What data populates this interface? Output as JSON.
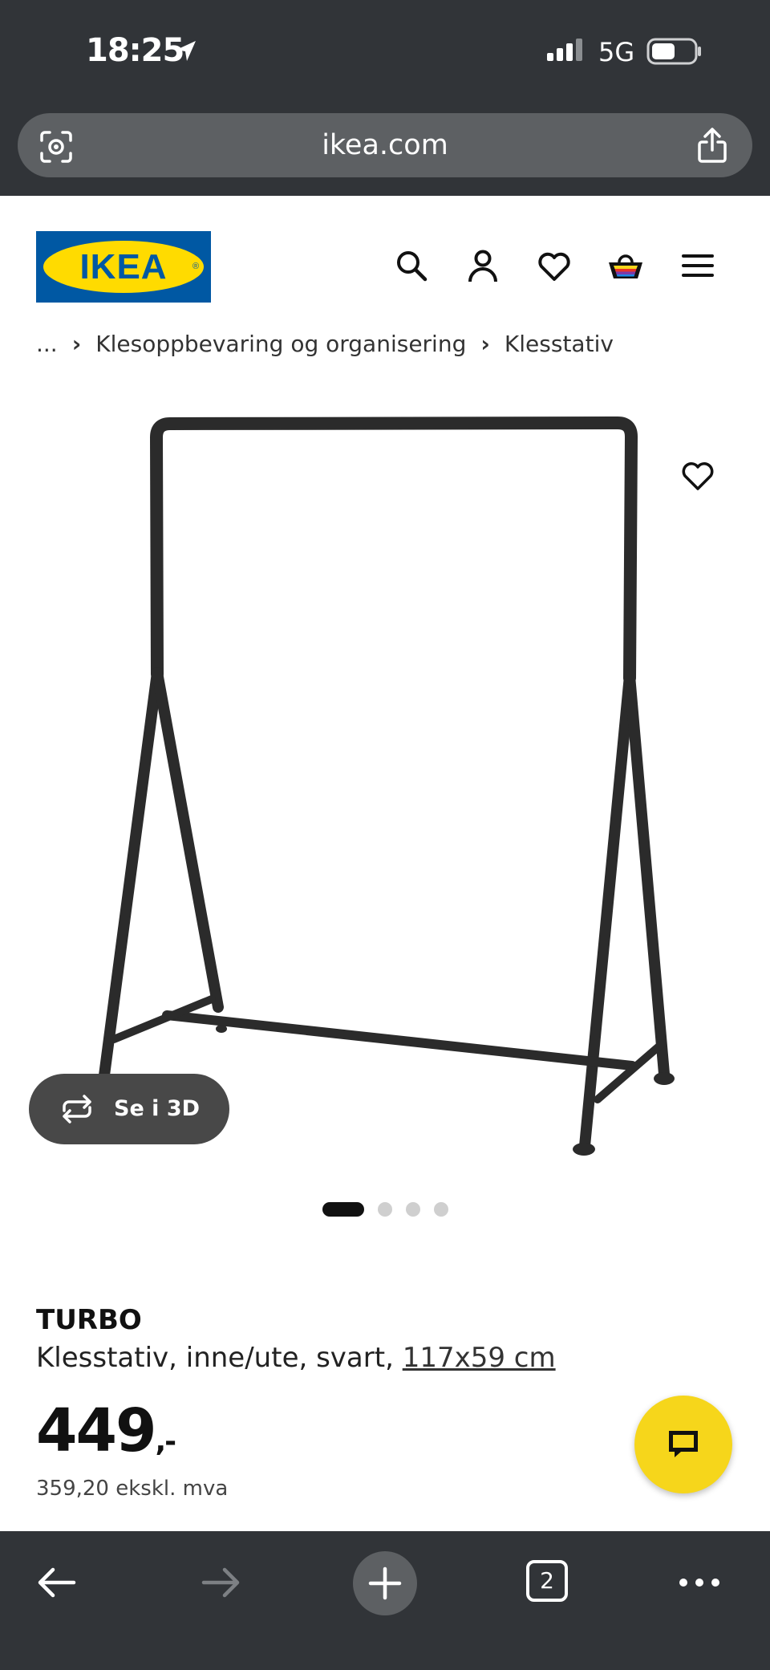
{
  "status_bar": {
    "time": "18:25",
    "network": "5G"
  },
  "browser": {
    "url": "ikea.com"
  },
  "header": {
    "logo_text": "IKEA",
    "icons": [
      "search-icon",
      "user-icon",
      "heart-icon",
      "cart-icon",
      "menu-icon"
    ],
    "colors": {
      "logo_blue": "#0058a3",
      "logo_yellow": "#ffdb00"
    }
  },
  "breadcrumb": {
    "items": [
      "...",
      "Klesoppbevaring og organisering",
      "Klesstativ"
    ]
  },
  "gallery": {
    "see_3d_label": "Se i 3D",
    "image_count": 4,
    "active_index": 1
  },
  "product": {
    "name": "TURBO",
    "description": "Klesstativ, inne/ute, svart, ",
    "dimensions": "117x59 cm",
    "price": "449",
    "price_suffix": ",-",
    "ex_vat": "359,20 ekskl. mva"
  },
  "chat": {
    "color": "#f6d61b"
  },
  "bottom_bar": {
    "tab_count": "2"
  }
}
